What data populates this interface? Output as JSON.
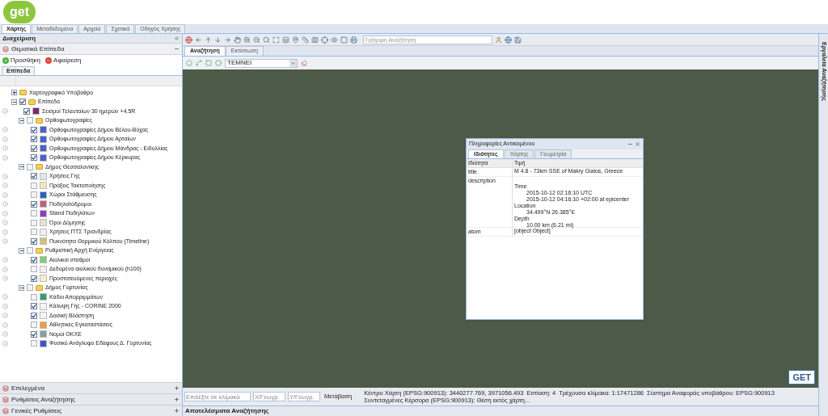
{
  "logo": {
    "text": "get"
  },
  "main_tabs": [
    {
      "label": "Χάρτης",
      "selected": true
    },
    {
      "label": "Μεταδεδομένα",
      "selected": false
    },
    {
      "label": "Αρχεία",
      "selected": false
    },
    {
      "label": "Σχετικά",
      "selected": false
    },
    {
      "label": "Οδηγός Χρήσης",
      "selected": false
    }
  ],
  "left_panel": {
    "title": "Διαχείριση",
    "section": "Θεματικά Επίπεδα",
    "actions": [
      {
        "label": "Προσθήκη",
        "kind": "add"
      },
      {
        "label": "Αφαίρεση",
        "kind": "remove"
      }
    ],
    "tabs": [
      {
        "label": "Επίπεδα",
        "selected": true
      }
    ],
    "tree": [
      {
        "kind": "group",
        "label": "Χαρτογραφικό Υπόβαθρο",
        "expanded": false
      },
      {
        "kind": "folder",
        "label": "Επίπεδα",
        "expanded": true,
        "checked": true,
        "children": [
          {
            "kind": "layer",
            "label": "Σεισμοί Τελευταίων 30 ημερών +4.5R",
            "checked": true,
            "color": "#7b2a6b"
          },
          {
            "kind": "folder",
            "label": "Ορθοφωτογραφίες",
            "expanded": true,
            "checked": false,
            "children": [
              {
                "kind": "layer",
                "label": "Ορθοφωτογραφίες Δήμου Βέλου-Βόχας",
                "checked": true,
                "color": "#4a5fd0"
              },
              {
                "kind": "layer",
                "label": "Ορθοφωτογραφίες Δήμου Αρταίων",
                "checked": true,
                "color": "#4a5fd0"
              },
              {
                "kind": "layer",
                "label": "Ορθοφωτογραφίες Δήμου Μάνδρας - Ειδυλλίας",
                "checked": true,
                "color": "#4a5fd0"
              },
              {
                "kind": "layer",
                "label": "Ορθοφωτογραφίες Δήμου Κέρκυρας",
                "checked": true,
                "color": "#4a5fd0"
              }
            ]
          },
          {
            "kind": "folder",
            "label": "Δήμος Θεσσαλονίκης",
            "expanded": true,
            "checked": false,
            "children": [
              {
                "kind": "layer",
                "label": "Χρήσεις Γης",
                "checked": true,
                "color": "#e4e4ee"
              },
              {
                "kind": "layer",
                "label": "Πράξεις Τακτοποίησης",
                "checked": false,
                "color": "#f3e9b8"
              },
              {
                "kind": "layer",
                "label": "Χώροι Στάθμευσης",
                "checked": false,
                "color": "#2b5fc8"
              },
              {
                "kind": "layer",
                "label": "Ποδηλατόδρομοι",
                "checked": true,
                "color": "#c0607a"
              },
              {
                "kind": "layer",
                "label": "Stand Ποδηλάτων",
                "checked": false,
                "color": "#8a3fc0"
              },
              {
                "kind": "layer",
                "label": "Όροι Δόμησης",
                "checked": false,
                "color": "#e8e0d0"
              },
              {
                "kind": "layer",
                "label": "Χρήσεις ΠΤΣ Τριανδρίας",
                "checked": false,
                "color": "#eef0f4"
              },
              {
                "kind": "layer",
                "label": "Πυκνότητα Θερμικού Κόλπου (Timeline)",
                "checked": true,
                "color": "#d8c070"
              }
            ]
          },
          {
            "kind": "folder",
            "label": "Ρυθμιστική Αρχή Ενέργειας",
            "expanded": true,
            "checked": false,
            "children": [
              {
                "kind": "layer",
                "label": "Αιολικοί σταθμοί",
                "checked": true,
                "color": "#7ad07a"
              },
              {
                "kind": "layer",
                "label": "Δεδομένα αιολικού δυναμικού (h100)",
                "checked": false,
                "color": "#f0f0f0"
              },
              {
                "kind": "layer",
                "label": "Προστατευόμενες περιοχές",
                "checked": true,
                "color": "#f8eec0"
              }
            ]
          },
          {
            "kind": "folder",
            "label": "Δήμος Γορτυνίας",
            "expanded": true,
            "checked": false,
            "children": [
              {
                "kind": "layer",
                "label": "Κάδοι Απορριμμάτων",
                "checked": false,
                "color": "#3a9a6a"
              },
              {
                "kind": "layer",
                "label": "Κάλυψη Γης - CORINE 2000",
                "checked": true,
                "color": "#f4f4f4"
              },
              {
                "kind": "layer",
                "label": "Δασική Βλάστηση",
                "checked": true,
                "color": "#f4f4f4"
              },
              {
                "kind": "layer",
                "label": "Αθλητικές Εγκαταστάσεις",
                "checked": false,
                "color": "#e8a040"
              },
              {
                "kind": "layer",
                "label": "Νομοί ΟΚΧΕ",
                "checked": true,
                "color": "#8aa0a0"
              },
              {
                "kind": "layer",
                "label": "Φυσικό Ανάγλυφο Εδάφους Δ. Γορτυνίας",
                "checked": false,
                "color": "#3a56c8"
              }
            ]
          }
        ]
      }
    ],
    "accordions": [
      "Επιλεγμένα",
      "Ρυθμίσεις Αναζήτησης",
      "Γενικές Ρυθμίσεις"
    ]
  },
  "toolbar": {
    "search": {
      "placeholder": "Γρήγορη Αναζήτηση"
    }
  },
  "map_tabs": [
    {
      "label": "Αναζήτηση",
      "selected": true
    },
    {
      "label": "Εκτύπωση",
      "selected": false
    }
  ],
  "search_tool": {
    "layer": "ΤΕΜΝΕΙ"
  },
  "map_logo": "GET",
  "popup": {
    "title": "Πληροφορίες Αντικειμένου",
    "tabs": [
      {
        "label": "Ιδιότητες",
        "selected": true
      },
      {
        "label": "Χάρτης",
        "selected": false
      },
      {
        "label": "Γεωμετρία",
        "selected": false
      }
    ],
    "columns": [
      "Ιδιότητα",
      "Τιμή"
    ],
    "rows": [
      {
        "property": "title",
        "lines": [
          {
            "kind": "value",
            "text": "M 4.8 - 73km SSE of Makry Gialos, Greece"
          }
        ]
      },
      {
        "property": "description",
        "lines": [
          {
            "kind": "label",
            "text": "Time"
          },
          {
            "kind": "indent",
            "text": "2015-10-12 02:16:10 UTC"
          },
          {
            "kind": "indent",
            "text": "2015-10-12 04:16:10 +02:00 at epicenter"
          },
          {
            "kind": "label",
            "text": "Location"
          },
          {
            "kind": "indent",
            "text": "34.499°N 26.385°E"
          },
          {
            "kind": "label",
            "text": "Depth"
          },
          {
            "kind": "indent",
            "text": "10.00 km (6.21 mi)"
          }
        ]
      },
      {
        "property": "atom",
        "lines": [
          {
            "kind": "value",
            "text": "[object Object]"
          }
        ]
      }
    ]
  },
  "status_bar": {
    "scale": {
      "placeholder": "Επιλέξτε σε κλίμακα"
    },
    "x": {
      "placeholder": "Χ/Γεωγρ."
    },
    "y": {
      "placeholder": "Υ/Γεωγρ."
    },
    "go": "Μετάβαση",
    "items": [
      "Κέντρο Χάρτη (EPSG:900913): 3440277.769, 3971056.493",
      "Εστίαση: 4",
      "Τρέχουσα κλίμακα: 1:17471286",
      "Σύστημα Αναφοράς υποβάθρου: EPSG:900913",
      "Συντεταγμένες Κέρσορα (EPSG:900913): Θέση εκτός χάρτη..."
    ]
  },
  "results_bar": {
    "title": "Αποτελέσματα Αναζήτησης"
  },
  "right_strip": {
    "title": "Εργαλεία Αναζήτησης"
  }
}
